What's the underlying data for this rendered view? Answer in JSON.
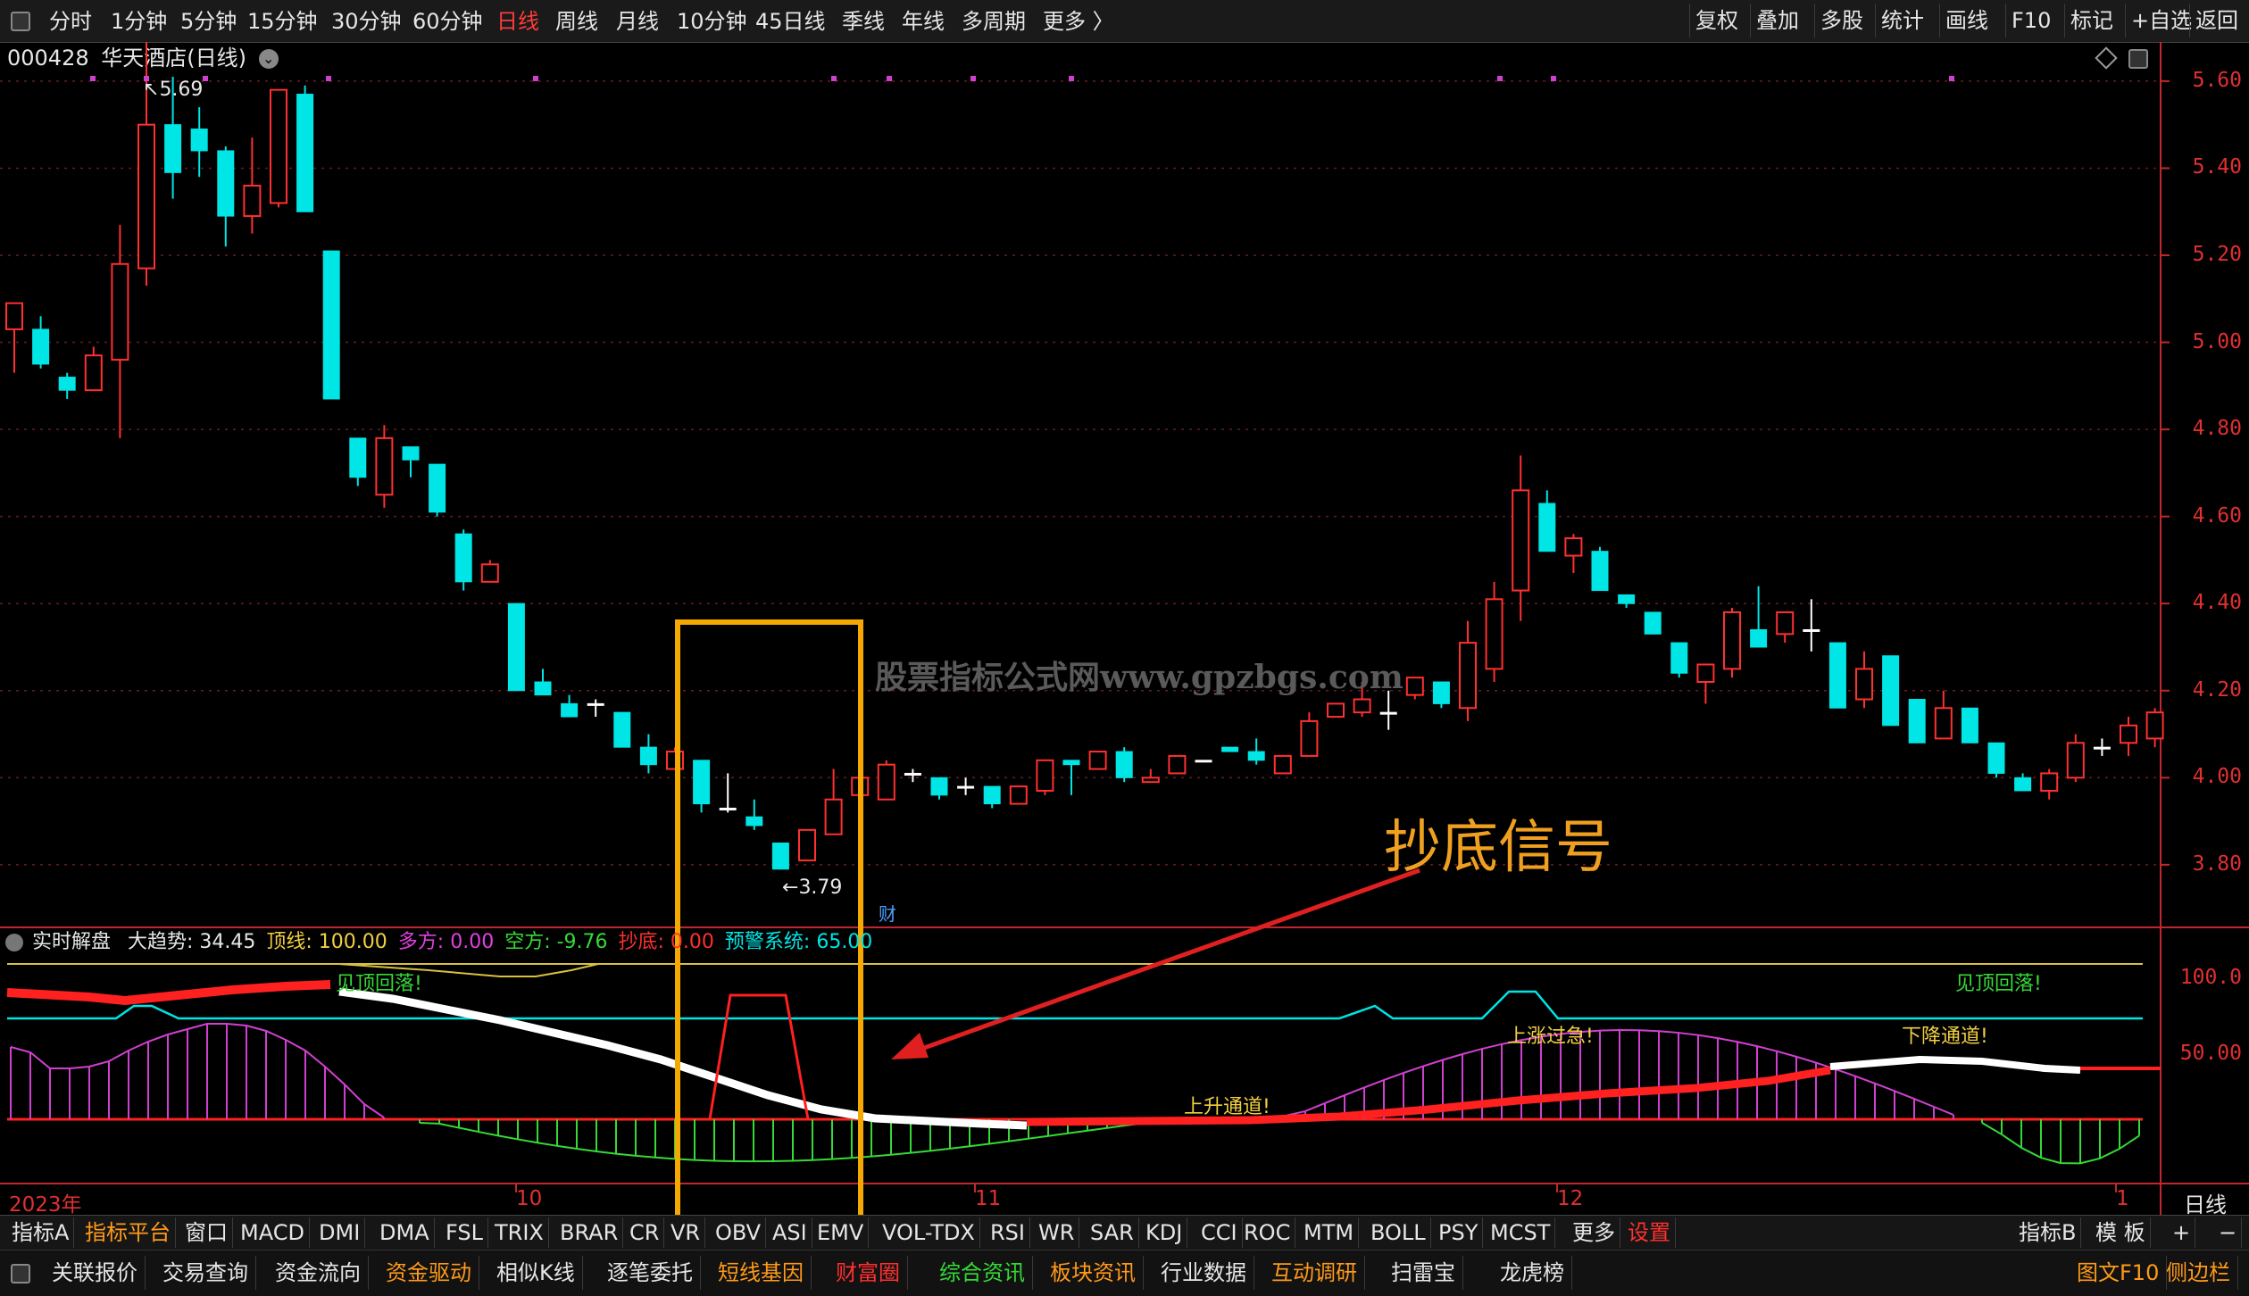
{
  "toolbar": {
    "periods": [
      {
        "label": "分时"
      },
      {
        "label": "1分钟"
      },
      {
        "label": "5分钟"
      },
      {
        "label": "15分钟"
      },
      {
        "label": "30分钟"
      },
      {
        "label": "60分钟"
      },
      {
        "label": "日线",
        "active": true
      },
      {
        "label": "周线"
      },
      {
        "label": "月线"
      },
      {
        "label": "10分钟"
      },
      {
        "label": "45日线"
      },
      {
        "label": "季线"
      },
      {
        "label": "年线"
      },
      {
        "label": "多周期"
      },
      {
        "label": "更多 〉"
      }
    ],
    "right": [
      {
        "label": "复权"
      },
      {
        "label": "叠加"
      },
      {
        "label": "多股"
      },
      {
        "label": "统计"
      },
      {
        "label": "画线"
      },
      {
        "label": "F10"
      },
      {
        "label": "标记"
      },
      {
        "label": "+自选"
      },
      {
        "label": "返回"
      }
    ]
  },
  "title": {
    "code": "000428",
    "name": "华天酒店(日线)"
  },
  "main_chart": {
    "high_mark": "5.69",
    "low_mark": "3.79",
    "fin_badge": "财",
    "y_labels": [
      "5.60",
      "5.40",
      "5.20",
      "5.00",
      "4.80",
      "4.60",
      "4.40",
      "4.20",
      "4.00",
      "3.80"
    ],
    "watermark": "股票指标公式网www.gpzbgs.com",
    "annotation": "抄底信号",
    "up_color": "#ff3030",
    "down_color": "#00e5e5"
  },
  "chart_data": {
    "type": "candlestick",
    "ylim": [
      3.73,
      5.69
    ],
    "ohlc": [
      [
        5.03,
        5.09,
        4.93,
        5.09
      ],
      [
        5.03,
        5.06,
        4.94,
        4.95
      ],
      [
        4.92,
        4.93,
        4.87,
        4.89
      ],
      [
        4.89,
        4.99,
        4.89,
        4.97
      ],
      [
        4.96,
        5.27,
        4.78,
        5.18
      ],
      [
        5.17,
        5.69,
        5.13,
        5.5
      ],
      [
        5.5,
        5.61,
        5.33,
        5.39
      ],
      [
        5.49,
        5.54,
        5.38,
        5.44
      ],
      [
        5.44,
        5.45,
        5.22,
        5.29
      ],
      [
        5.29,
        5.47,
        5.25,
        5.36
      ],
      [
        5.32,
        5.58,
        5.31,
        5.58
      ],
      [
        5.57,
        5.59,
        5.3,
        5.3
      ],
      [
        5.21,
        5.21,
        4.87,
        4.87
      ],
      [
        4.78,
        4.78,
        4.67,
        4.69
      ],
      [
        4.65,
        4.81,
        4.62,
        4.78
      ],
      [
        4.76,
        4.76,
        4.69,
        4.73
      ],
      [
        4.72,
        4.72,
        4.6,
        4.61
      ],
      [
        4.56,
        4.57,
        4.43,
        4.45
      ],
      [
        4.45,
        4.5,
        4.45,
        4.49
      ],
      [
        4.4,
        4.4,
        4.2,
        4.2
      ],
      [
        4.22,
        4.25,
        4.19,
        4.19
      ],
      [
        4.17,
        4.19,
        4.14,
        4.14
      ],
      [
        4.17,
        4.18,
        4.14,
        4.17
      ],
      [
        4.15,
        4.15,
        4.07,
        4.07
      ],
      [
        4.07,
        4.1,
        4.01,
        4.03
      ],
      [
        4.02,
        4.07,
        4.02,
        4.06
      ],
      [
        4.04,
        4.04,
        3.92,
        3.94
      ],
      [
        3.93,
        4.01,
        3.92,
        3.93
      ],
      [
        3.91,
        3.95,
        3.88,
        3.89
      ],
      [
        3.85,
        3.85,
        3.79,
        3.79
      ],
      [
        3.81,
        3.88,
        3.81,
        3.88
      ],
      [
        3.87,
        4.02,
        3.87,
        3.95
      ],
      [
        3.96,
        4.0,
        3.96,
        4.0
      ],
      [
        3.95,
        4.04,
        3.95,
        4.03
      ],
      [
        4.01,
        4.02,
        3.99,
        4.01
      ],
      [
        4.0,
        4.0,
        3.95,
        3.96
      ],
      [
        3.98,
        4.0,
        3.96,
        3.98
      ],
      [
        3.98,
        3.98,
        3.93,
        3.94
      ],
      [
        3.94,
        3.98,
        3.94,
        3.98
      ],
      [
        3.97,
        4.04,
        3.96,
        4.04
      ],
      [
        4.04,
        4.04,
        3.96,
        4.03
      ],
      [
        4.02,
        4.06,
        4.02,
        4.06
      ],
      [
        4.06,
        4.07,
        3.99,
        4.0
      ],
      [
        3.99,
        4.02,
        3.99,
        4.0
      ],
      [
        4.01,
        4.05,
        4.01,
        4.05
      ],
      [
        4.04,
        4.04,
        4.04,
        4.04
      ],
      [
        4.07,
        4.07,
        4.06,
        4.06
      ],
      [
        4.06,
        4.09,
        4.03,
        4.04
      ],
      [
        4.01,
        4.05,
        4.01,
        4.05
      ],
      [
        4.05,
        4.15,
        4.05,
        4.13
      ],
      [
        4.14,
        4.17,
        4.14,
        4.17
      ],
      [
        4.15,
        4.22,
        4.14,
        4.18
      ],
      [
        4.15,
        4.2,
        4.11,
        4.15
      ],
      [
        4.19,
        4.23,
        4.18,
        4.23
      ],
      [
        4.22,
        4.22,
        4.16,
        4.17
      ],
      [
        4.16,
        4.36,
        4.13,
        4.31
      ],
      [
        4.25,
        4.45,
        4.22,
        4.41
      ],
      [
        4.43,
        4.74,
        4.36,
        4.66
      ],
      [
        4.63,
        4.66,
        4.52,
        4.52
      ],
      [
        4.51,
        4.56,
        4.47,
        4.55
      ],
      [
        4.52,
        4.53,
        4.43,
        4.43
      ],
      [
        4.42,
        4.42,
        4.39,
        4.4
      ],
      [
        4.38,
        4.38,
        4.33,
        4.33
      ],
      [
        4.31,
        4.31,
        4.23,
        4.24
      ],
      [
        4.22,
        4.26,
        4.17,
        4.26
      ],
      [
        4.25,
        4.39,
        4.23,
        4.38
      ],
      [
        4.34,
        4.44,
        4.3,
        4.3
      ],
      [
        4.33,
        4.38,
        4.31,
        4.38
      ],
      [
        4.34,
        4.41,
        4.29,
        4.34
      ],
      [
        4.31,
        4.31,
        4.16,
        4.16
      ],
      [
        4.18,
        4.29,
        4.16,
        4.25
      ],
      [
        4.28,
        4.28,
        4.12,
        4.12
      ],
      [
        4.18,
        4.18,
        4.08,
        4.08
      ],
      [
        4.09,
        4.2,
        4.09,
        4.16
      ],
      [
        4.16,
        4.16,
        4.08,
        4.08
      ],
      [
        4.08,
        4.08,
        4.0,
        4.01
      ],
      [
        4.0,
        4.01,
        3.97,
        3.97
      ],
      [
        3.97,
        4.02,
        3.95,
        4.01
      ],
      [
        4.0,
        4.1,
        3.99,
        4.08
      ],
      [
        4.07,
        4.09,
        4.05,
        4.07
      ],
      [
        4.08,
        4.14,
        4.05,
        4.12
      ],
      [
        4.09,
        4.16,
        4.07,
        4.15
      ]
    ]
  },
  "indicator": {
    "label": "实时解盘",
    "items": [
      {
        "label": "大趋势: 34.45",
        "color": "#e6e6e6"
      },
      {
        "label": "顶线: 100.00",
        "color": "#f0d040"
      },
      {
        "label": "多方: 0.00",
        "color": "#e040e0"
      },
      {
        "label": "空方: -9.76",
        "color": "#36d936"
      },
      {
        "label": "抄底: 0.00",
        "color": "#ff3030"
      },
      {
        "label": "预警系统: 65.00",
        "color": "#00e5e5"
      }
    ],
    "y_labels": [
      "100.0",
      "50.00"
    ],
    "notes": {
      "top_fall_left": "见顶回落!",
      "top_fall_right": "见顶回落!",
      "up_channel": "上升通道!",
      "rise_over": "上涨过急!",
      "down_channel": "下降通道!"
    }
  },
  "x_axis": {
    "labels": [
      "2023年",
      "10",
      "11",
      "12",
      "1"
    ],
    "period": "日线"
  },
  "tabs_row1": [
    {
      "label": "指标A"
    },
    {
      "label": "指标平台",
      "color": "org"
    },
    {
      "label": "窗口"
    },
    {
      "label": "MACD"
    },
    {
      "label": "DMI"
    },
    {
      "label": "DMA"
    },
    {
      "label": "FSL"
    },
    {
      "label": "TRIX"
    },
    {
      "label": "BRAR"
    },
    {
      "label": "CR"
    },
    {
      "label": "VR"
    },
    {
      "label": "OBV"
    },
    {
      "label": "ASI"
    },
    {
      "label": "EMV"
    },
    {
      "label": "VOL-TDX"
    },
    {
      "label": "RSI"
    },
    {
      "label": "WR"
    },
    {
      "label": "SAR"
    },
    {
      "label": "KDJ"
    },
    {
      "label": "CCI"
    },
    {
      "label": "ROC"
    },
    {
      "label": "MTM"
    },
    {
      "label": "BOLL"
    },
    {
      "label": "PSY"
    },
    {
      "label": "MCST"
    },
    {
      "label": "更多"
    },
    {
      "label": "设置",
      "color": "red"
    }
  ],
  "tabs_row1_right": [
    {
      "label": "指标B"
    },
    {
      "label": "模 板"
    },
    {
      "label": "+"
    },
    {
      "label": "−"
    }
  ],
  "tabs_row2": [
    {
      "label": "关联报价"
    },
    {
      "label": "交易查询"
    },
    {
      "label": "资金流向"
    },
    {
      "label": "资金驱动",
      "color": "org"
    },
    {
      "label": "相似K线"
    },
    {
      "label": "逐笔委托"
    },
    {
      "label": "短线基因",
      "color": "org"
    },
    {
      "label": "财富圈",
      "color": "red"
    },
    {
      "label": "综合资讯",
      "color": "grn"
    },
    {
      "label": "板块资讯",
      "color": "org"
    },
    {
      "label": "行业数据"
    },
    {
      "label": "互动调研",
      "color": "org"
    },
    {
      "label": "扫雷宝"
    },
    {
      "label": "龙虎榜"
    }
  ],
  "tabs_row2_right": [
    {
      "label": "图文F10",
      "color": "org"
    },
    {
      "label": "侧边栏",
      "color": "org"
    }
  ]
}
